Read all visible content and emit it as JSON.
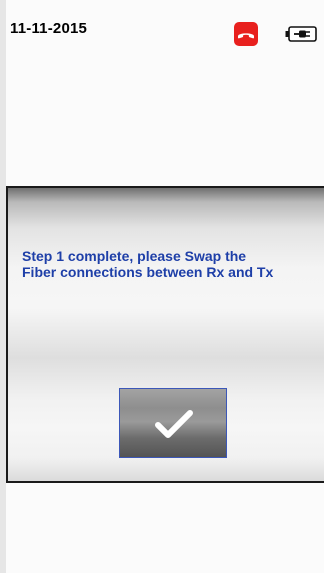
{
  "status_bar": {
    "date": "11-11-2015",
    "call_icon": "hang-up-phone-icon",
    "battery_icon": "battery-charging-icon"
  },
  "dialog": {
    "message_line1": "Step 1 complete, please Swap the",
    "message_line2": "Fiber connections between Rx and Tx",
    "confirm_icon": "checkmark-icon",
    "message_color": "#1e3fa8",
    "accent_color": "#e8201e"
  }
}
